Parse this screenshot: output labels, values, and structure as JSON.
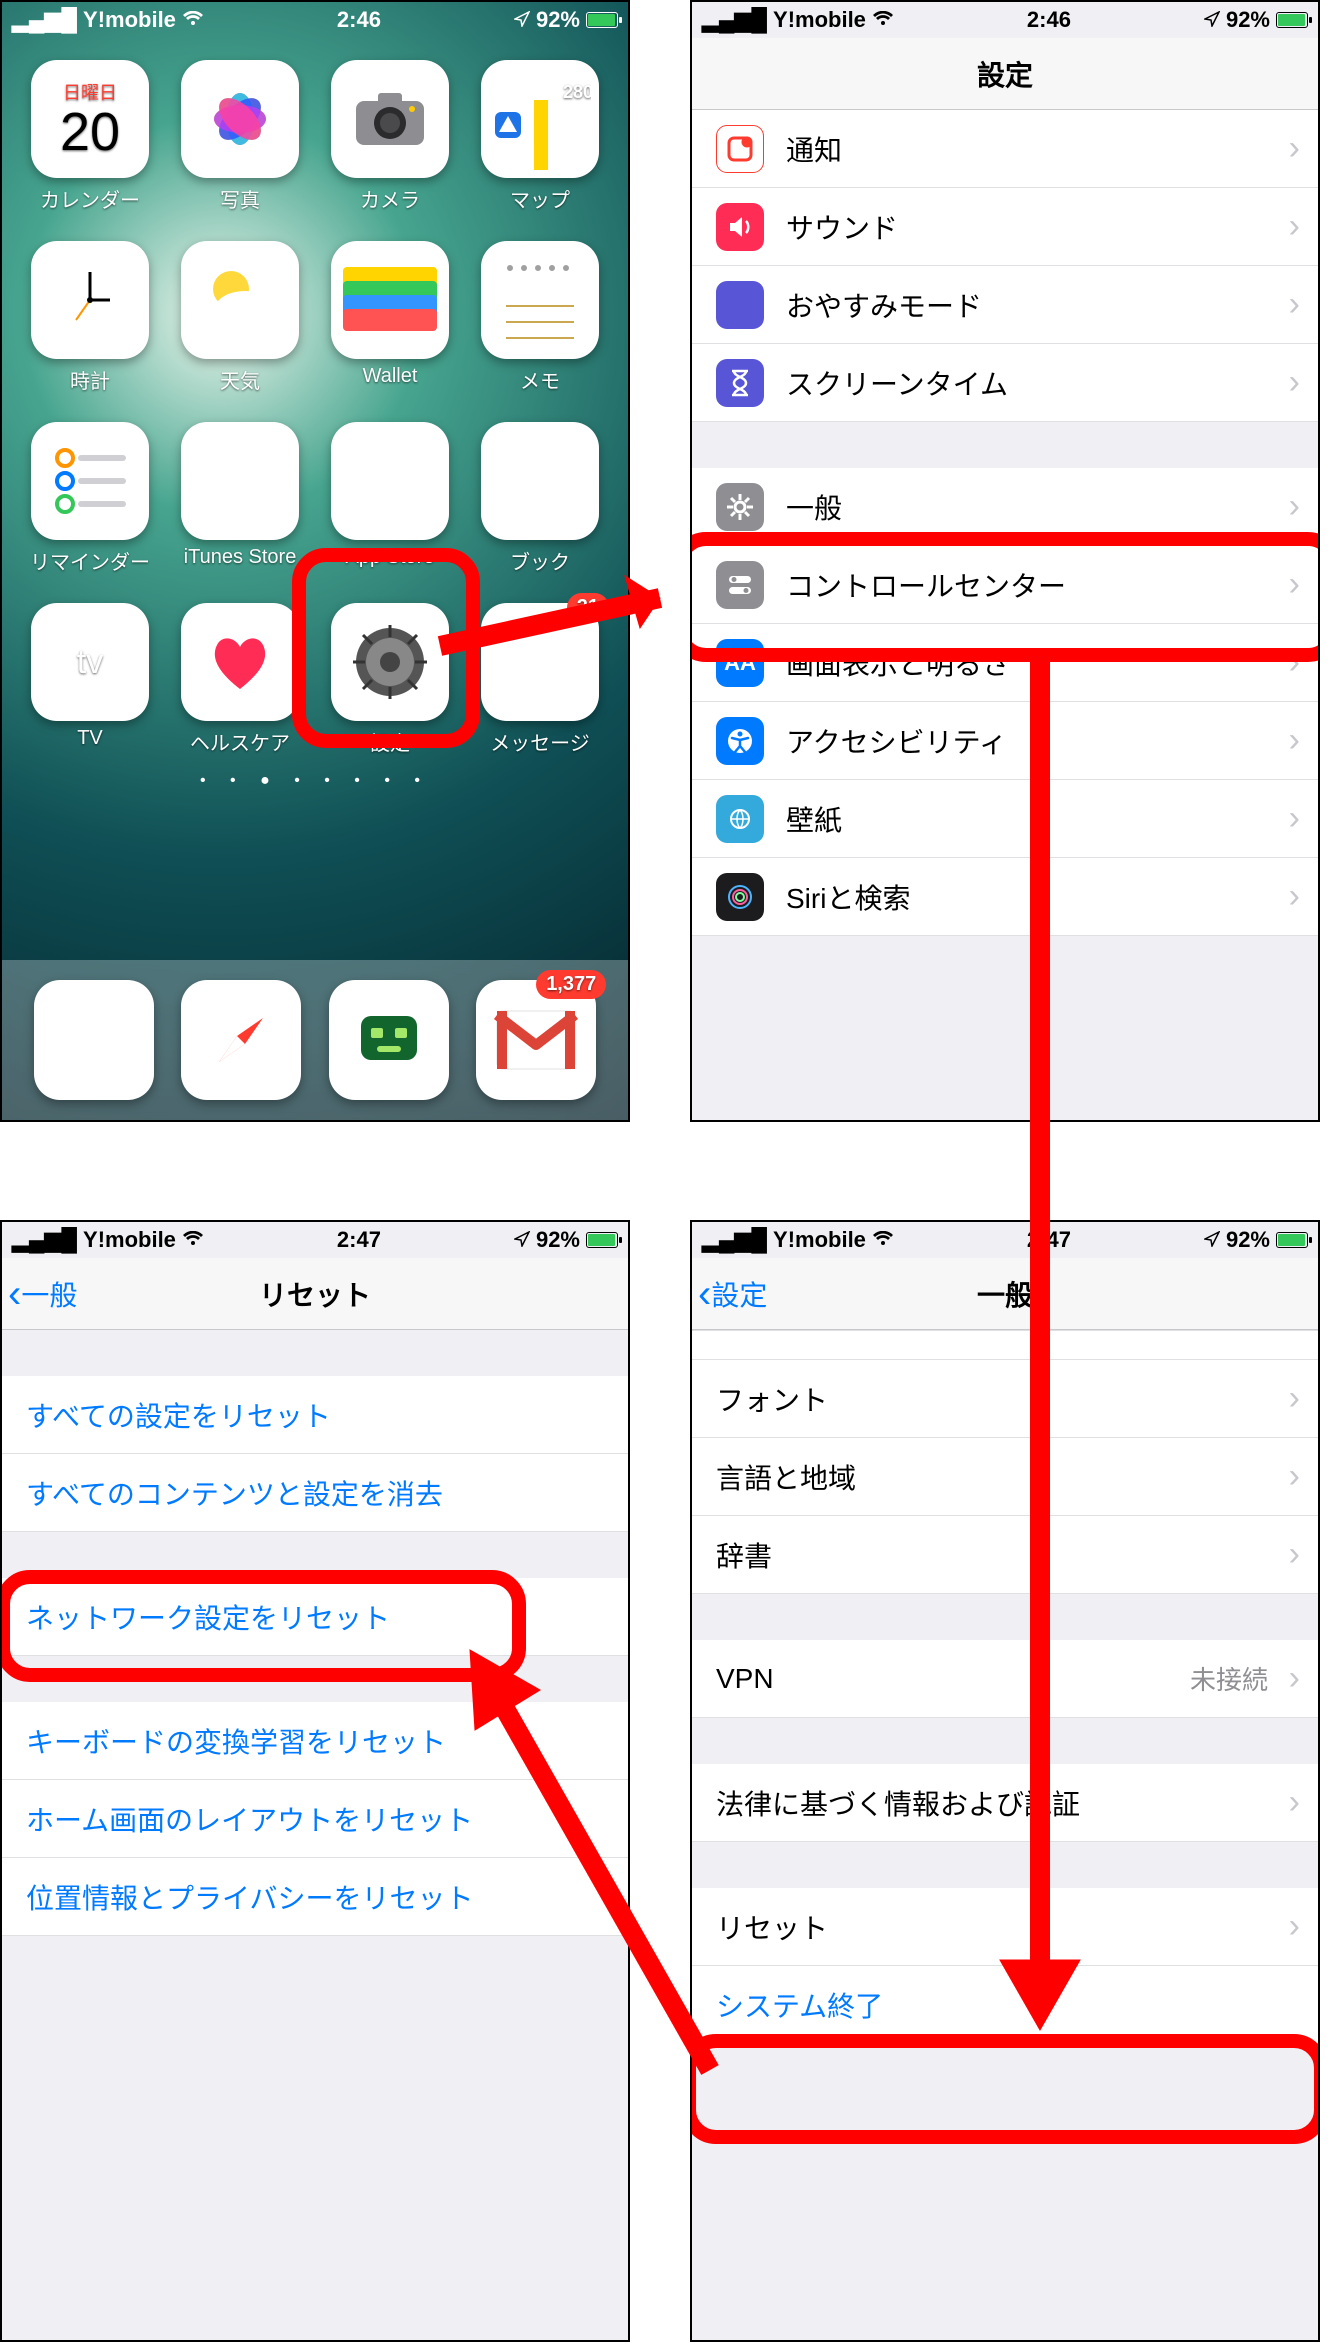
{
  "status": {
    "carrier": "Y!mobile",
    "time1": "2:46",
    "time2": "2:47",
    "battery": "92%"
  },
  "home": {
    "apps": [
      {
        "label": "カレンダー",
        "dow": "日曜日",
        "num": "20"
      },
      {
        "label": "写真"
      },
      {
        "label": "カメラ"
      },
      {
        "label": "マップ"
      },
      {
        "label": "時計"
      },
      {
        "label": "天気"
      },
      {
        "label": "Wallet"
      },
      {
        "label": "メモ"
      },
      {
        "label": "リマインダー"
      },
      {
        "label": "iTunes Store"
      },
      {
        "label": "App Store"
      },
      {
        "label": "ブック"
      },
      {
        "label": "TV"
      },
      {
        "label": "ヘルスケア"
      },
      {
        "label": "設定"
      },
      {
        "label": "メッセージ",
        "badge": "21"
      }
    ],
    "dock": [
      {
        "name": "phone"
      },
      {
        "name": "safari"
      },
      {
        "name": "roboform"
      },
      {
        "name": "gmail",
        "badge": "1,377"
      }
    ],
    "dots": "• • ● • • • • •"
  },
  "settings": {
    "title": "設定",
    "rows": [
      {
        "icon": "si-nored",
        "label": "通知"
      },
      {
        "icon": "si-redg",
        "label": "サウンド"
      },
      {
        "icon": "si-indigo",
        "label": "おやすみモード"
      },
      {
        "icon": "si-indigo",
        "label": "スクリーンタイム"
      }
    ],
    "rows2": [
      {
        "icon": "si-gray",
        "label": "一般"
      },
      {
        "icon": "si-gray",
        "label": "コントロールセンター"
      },
      {
        "icon": "si-blueA",
        "label": "画面表示と明るさ"
      },
      {
        "icon": "si-blue",
        "label": "アクセシビリティ"
      },
      {
        "icon": "si-cyan",
        "label": "壁紙"
      },
      {
        "icon": "si-black",
        "label": "Siriと検索"
      }
    ]
  },
  "general": {
    "back": "設定",
    "title": "一般",
    "rows": [
      {
        "label": "フォント"
      },
      {
        "label": "言語と地域"
      },
      {
        "label": "辞書"
      }
    ],
    "vpn": {
      "label": "VPN",
      "val": "未接続"
    },
    "rows2": [
      {
        "label": "法律に基づく情報および認証"
      }
    ],
    "reset": {
      "label": "リセット"
    },
    "shutdown": {
      "label": "システム終了"
    }
  },
  "reset": {
    "back": "一般",
    "title": "リセット",
    "g1": [
      {
        "label": "すべての設定をリセット"
      },
      {
        "label": "すべてのコンテンツと設定を消去"
      }
    ],
    "g2": [
      {
        "label": "ネットワーク設定をリセット"
      }
    ],
    "g3": [
      {
        "label": "キーボードの変換学習をリセット"
      },
      {
        "label": "ホーム画面のレイアウトをリセット"
      },
      {
        "label": "位置情報とプライバシーをリセット"
      }
    ]
  }
}
